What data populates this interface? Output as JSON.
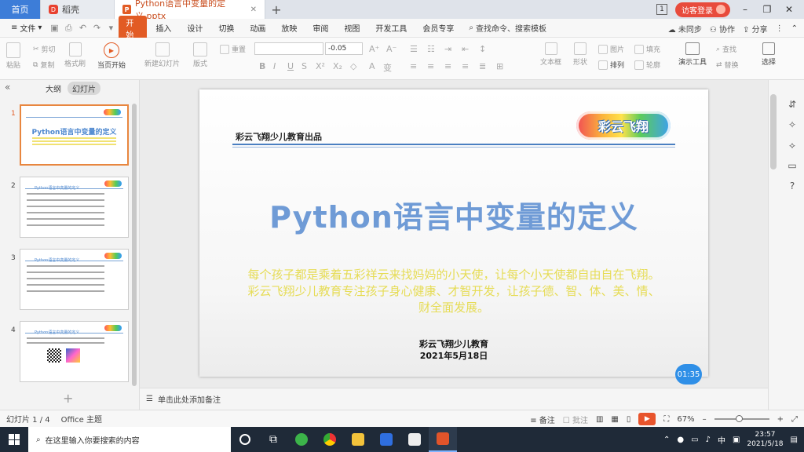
{
  "tabs": {
    "home": "首页",
    "docer": "稻壳",
    "file": "Python语言中变量的定义.pptx"
  },
  "titlebar": {
    "page_badge": "1",
    "visitor_login": "访客登录"
  },
  "menu": {
    "file": "文件",
    "items": [
      "开始",
      "插入",
      "设计",
      "切换",
      "动画",
      "放映",
      "审阅",
      "视图",
      "开发工具",
      "会员专享"
    ],
    "search": "查找命令、搜索模板",
    "right": [
      "未同步",
      "协作",
      "分享"
    ]
  },
  "toolbar": {
    "paste": "粘贴",
    "cut": "剪切",
    "copy": "复制",
    "format_painter": "格式刷",
    "play_from_current": "当页开始",
    "new_slide": "新建幻灯片",
    "layout": "版式",
    "reset": "重置",
    "font_size": "-0.05",
    "text_box": "文本框",
    "shape": "形状",
    "arrange": "排列",
    "picture": "图片",
    "fill": "填充",
    "outline": "轮廓",
    "find": "查找",
    "replace": "替换",
    "presentation_tools": "演示工具",
    "select": "选择"
  },
  "leftpanel": {
    "outline_tab": "大纲",
    "slides_tab": "幻灯片",
    "thumbs": [
      {
        "num": "1",
        "title": "Python语言中变量的定义"
      },
      {
        "num": "2",
        "title": "Python语言中变量的定义"
      },
      {
        "num": "3",
        "title": "Python语言中变量的定义"
      },
      {
        "num": "4",
        "title": "Python语言中变量的定义"
      }
    ]
  },
  "slide": {
    "header": "彩云飞翔少儿教育出品",
    "logo": "彩云飞翔",
    "title": "Python语言中变量的定义",
    "desc": "每个孩子都是乘着五彩祥云来找妈妈的小天使，让每个小天使都自由自在飞翔。彩云飞翔少儿教育专注孩子身心健康、才智开发，让孩子德、智、体、美、情、财全面发展。",
    "org": "彩云飞翔少儿教育",
    "date": "2021年5月18日",
    "timer": "01:35"
  },
  "notes": {
    "placeholder": "单击此处添加备注"
  },
  "statusbar": {
    "slide_info": "幻灯片 1 / 4",
    "theme": "Office 主题",
    "notes": "备注",
    "comments": "批注",
    "zoom": "67%",
    "zoom_level": 0.45
  },
  "taskbar": {
    "search_placeholder": "在这里输入你要搜索的内容",
    "ime": "中",
    "time": "23:57",
    "date": "2021/5/18"
  }
}
